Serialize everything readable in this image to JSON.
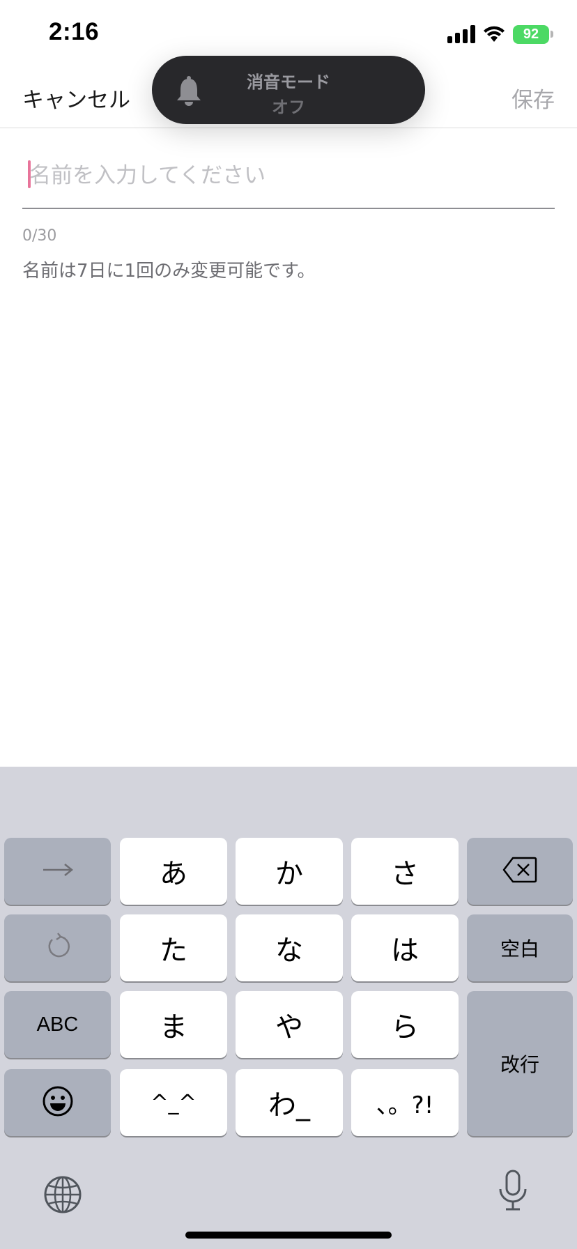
{
  "status_bar": {
    "time": "2:16",
    "battery_level": "92",
    "battery_color": "#4cd964",
    "icons": [
      "signal-icon",
      "wifi-icon",
      "battery-charging-icon"
    ]
  },
  "silent_banner": {
    "title": "消音モード",
    "subtitle": "オフ",
    "icon": "bell-icon"
  },
  "nav": {
    "cancel_label": "キャンセル",
    "save_label": "保存"
  },
  "name_form": {
    "value": "",
    "placeholder": "名前を入力してください",
    "counter": "0/30",
    "helper": "名前は7日に1回のみ変更可能です。",
    "caret_color": "#e8749a"
  },
  "keyboard": {
    "arrow_icon": "right-arrow-icon",
    "undo_icon": "undo-icon",
    "abc_label": "ABC",
    "emoji_icon": "emoji-icon",
    "kana": [
      "あ",
      "か",
      "さ",
      "た",
      "な",
      "は",
      "ま",
      "や",
      "ら",
      "^_^",
      "わ_",
      "、。?!"
    ],
    "delete_icon": "delete-icon",
    "space_label": "空白",
    "return_label": "改行",
    "globe_icon": "globe-icon",
    "mic_icon": "microphone-icon"
  }
}
